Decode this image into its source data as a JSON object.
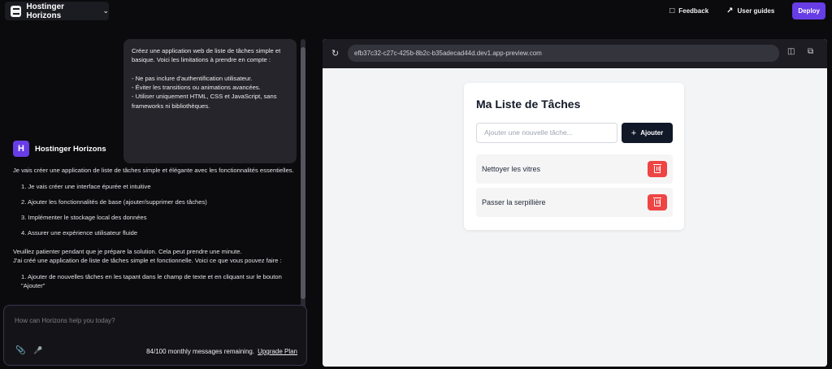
{
  "topbar": {
    "brand_name": "Hostinger Horizons",
    "feedback_label": "Feedback",
    "user_guides_label": "User guides",
    "deploy_label": "Deploy"
  },
  "chat": {
    "user_message": "Créez une application web de liste de tâches simple et basique. Voici les limitations à prendre en compte :\n\n- Ne pas inclure d'authentification utilisateur.\n- Éviter les transitions ou animations avancées.\n- Utiliser uniquement HTML, CSS et JavaScript, sans frameworks ni bibliothèques.",
    "assistant_name": "Hostinger Horizons",
    "intro": "Je vais créer une application de liste de tâches simple et élégante avec les fonctionnalités essentielles.",
    "steps": [
      "1. Je vais créer une interface épurée et intuitive",
      "2. Ajouter les fonctionnalités de base (ajouter/supprimer des tâches)",
      "3. Implémenter le stockage local des données",
      "4. Assurer une expérience utilisateur fluide"
    ],
    "waiting": "Veuillez patienter pendant que je prépare la solution. Cela peut prendre une minute.",
    "created": "J'ai créé une application de liste de tâches simple et fonctionnelle. Voici ce que vous pouvez faire :",
    "features": [
      "1. Ajouter de nouvelles tâches en les tapant dans le champ de texte et en cliquant sur le bouton \"Ajouter\""
    ]
  },
  "composer": {
    "placeholder": "How can Horizons help you today?",
    "remaining": "84/100 monthly messages remaining.",
    "upgrade_label": "Upgrade Plan"
  },
  "preview": {
    "url": "efb37c32-c27c-425b-8b2c-b35adecad44d.dev1.app-preview.com",
    "app": {
      "title": "Ma Liste de Tâches",
      "input_placeholder": "Ajouter une nouvelle tâche...",
      "add_label": "Ajouter",
      "tasks": [
        {
          "label": "Nettoyer les vitres"
        },
        {
          "label": "Passer la serpillière"
        }
      ]
    }
  },
  "colors": {
    "accent": "#673de6",
    "delete": "#ef4444",
    "add_button": "#111827"
  }
}
